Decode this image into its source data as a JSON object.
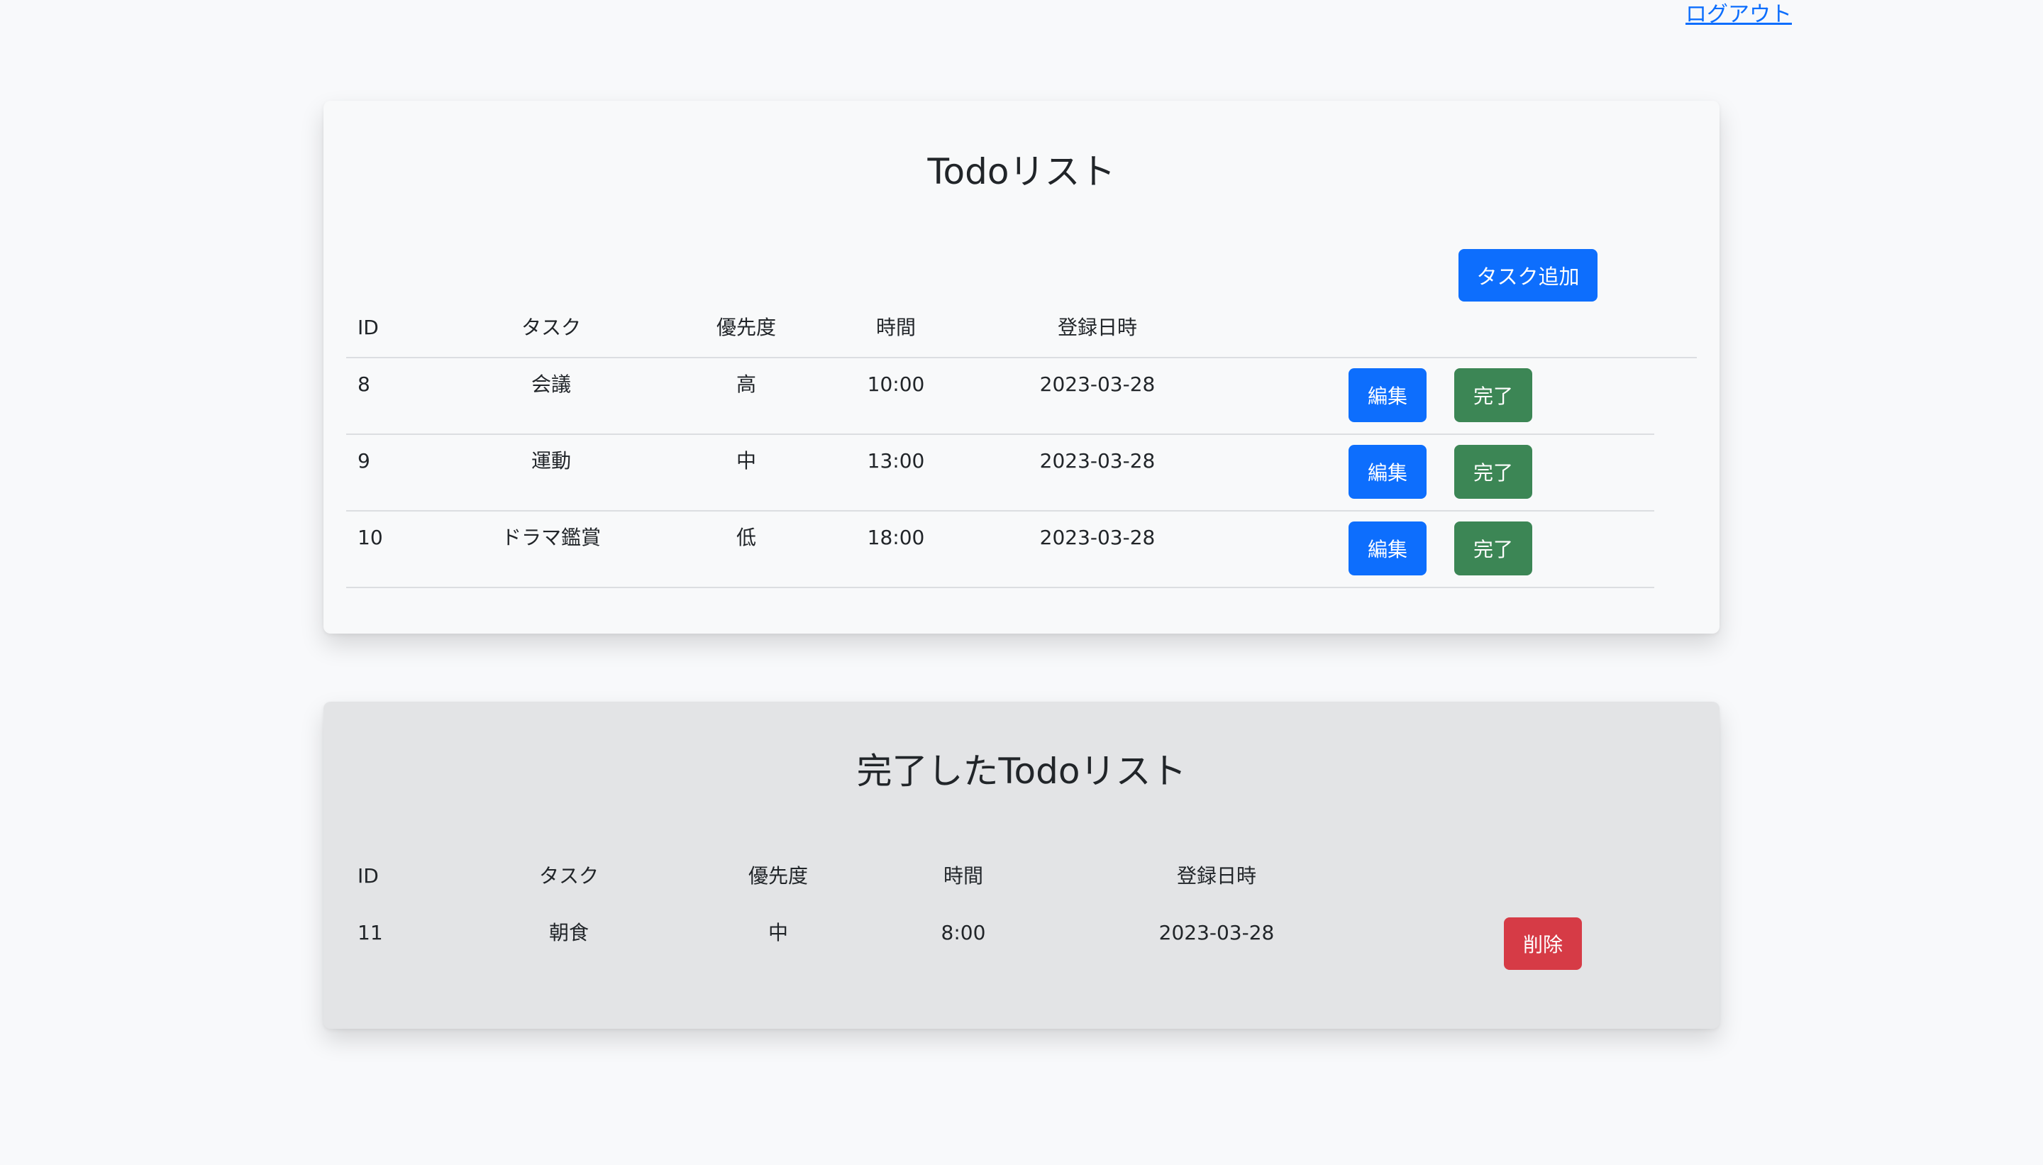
{
  "header": {
    "logout_label": "ログアウト"
  },
  "active": {
    "title": "Todoリスト",
    "add_button": "タスク追加",
    "columns": {
      "id": "ID",
      "task": "タスク",
      "priority": "優先度",
      "time": "時間",
      "date": "登録日時"
    },
    "rows": [
      {
        "id": "8",
        "task": "会議",
        "priority": "高",
        "time": "10:00",
        "date": "2023-03-28"
      },
      {
        "id": "9",
        "task": "運動",
        "priority": "中",
        "time": "13:00",
        "date": "2023-03-28"
      },
      {
        "id": "10",
        "task": "ドラマ鑑賞",
        "priority": "低",
        "time": "18:00",
        "date": "2023-03-28"
      }
    ],
    "edit_label": "編集",
    "complete_label": "完了"
  },
  "done": {
    "title": "完了したTodoリスト",
    "columns": {
      "id": "ID",
      "task": "タスク",
      "priority": "優先度",
      "time": "時間",
      "date": "登録日時"
    },
    "rows": [
      {
        "id": "11",
        "task": "朝食",
        "priority": "中",
        "time": "8:00",
        "date": "2023-03-28"
      }
    ],
    "delete_label": "削除"
  },
  "colors": {
    "page_background": "#f8f9fb",
    "primary": "#0d6efd",
    "success": "#3c8655",
    "danger": "#d63b46",
    "done_card_background": "#e3e4e6"
  }
}
